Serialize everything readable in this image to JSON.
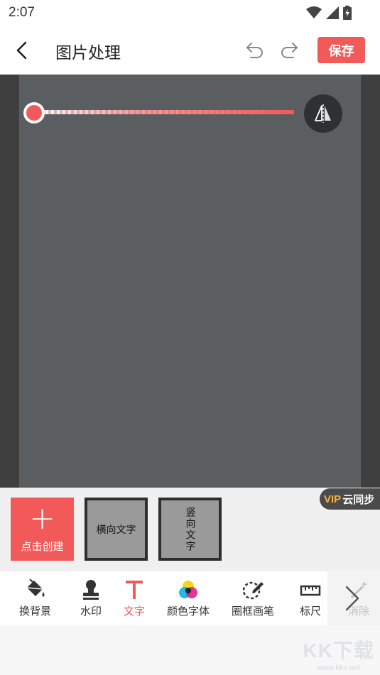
{
  "status_bar": {
    "time": "2:07"
  },
  "header": {
    "title": "图片处理",
    "save_label": "保存"
  },
  "canvas": {
    "opacity_slider_value": 0.0
  },
  "templates": {
    "create_label": "点击创建",
    "horizontal_label": "横向文字",
    "vertical_label": "竖向文字",
    "vip_text": "VIP",
    "sync_text": "云同步"
  },
  "toolbar": {
    "items": [
      {
        "label": "换背景",
        "icon": "paint-bucket-icon"
      },
      {
        "label": "水印",
        "icon": "stamp-icon"
      },
      {
        "label": "文字",
        "icon": "text-t-icon",
        "active": true
      },
      {
        "label": "颜色字体",
        "icon": "color-wheel-icon"
      },
      {
        "label": "圈框画笔",
        "icon": "circle-pen-icon"
      },
      {
        "label": "标尺",
        "icon": "ruler-icon"
      },
      {
        "label": "消除",
        "icon": "magic-wand-icon"
      }
    ]
  },
  "watermark": {
    "logo": "KK下载",
    "url": "www.kkx.net"
  },
  "colors": {
    "accent": "#f25a5a",
    "vip": "#f5b23c",
    "canvas_bg": "#5a5e60"
  }
}
